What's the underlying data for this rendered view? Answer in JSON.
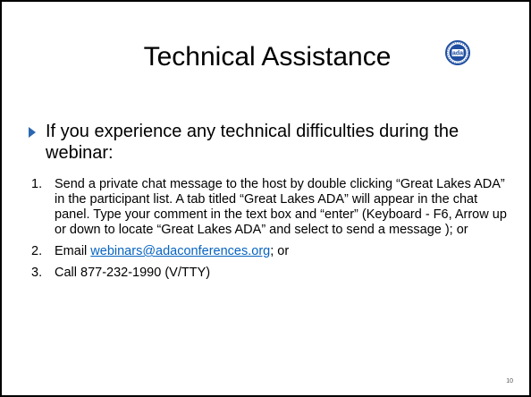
{
  "slide": {
    "title": "Technical Assistance",
    "logo_text": "ada",
    "intro": "If you experience any technical difficulties during the webinar:",
    "items": [
      {
        "num": "1.",
        "text": "Send a private chat message to the host by double clicking “Great Lakes ADA” in the participant list. A tab titled “Great Lakes ADA” will appear in the chat panel. Type your comment in the text box and “enter” (Keyboard - F6, Arrow up or down to locate “Great Lakes ADA” and select to send a message ); or"
      },
      {
        "num": "2.",
        "prefix": "Email ",
        "link": "webinars@adaconferences.org",
        "suffix": "; or"
      },
      {
        "num": "3.",
        "text": "Call 877-232-1990 (V/TTY)"
      }
    ],
    "page_number": "10"
  },
  "colors": {
    "bullet": "#2c67b1",
    "link": "#0563c1",
    "logo": "#1f4ea1"
  }
}
